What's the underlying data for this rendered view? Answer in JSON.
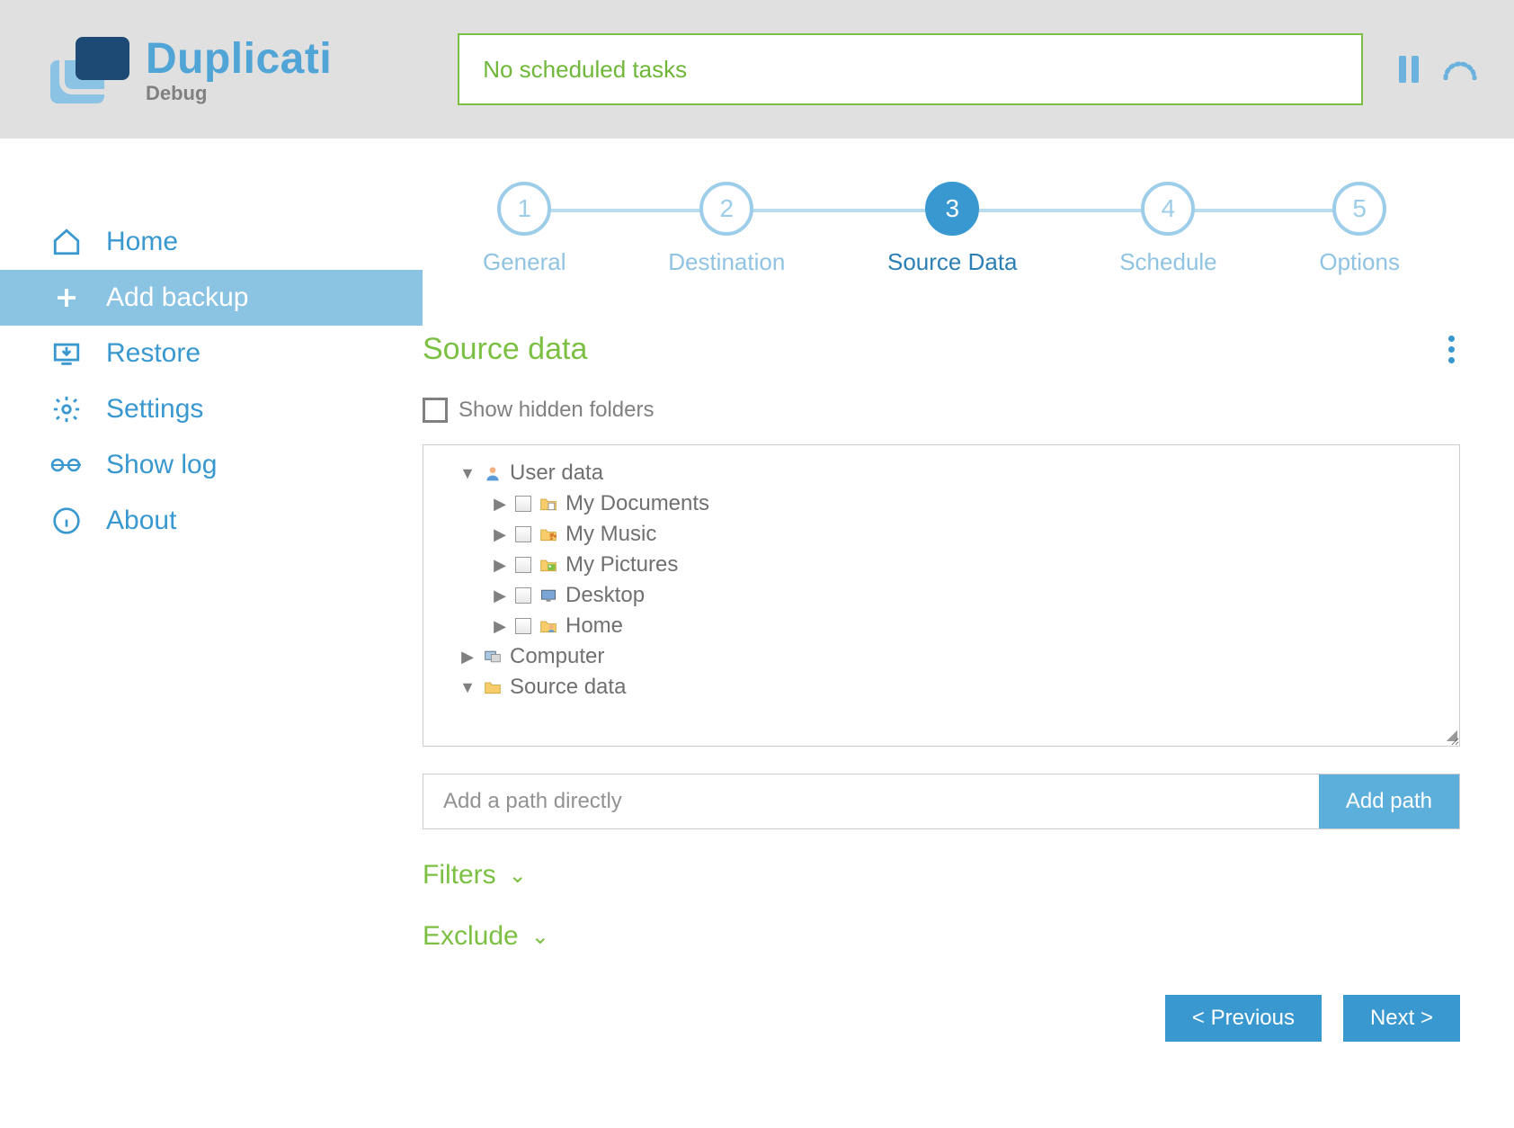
{
  "header": {
    "app_name": "Duplicati",
    "app_sub": "Debug",
    "status": "No scheduled tasks"
  },
  "sidebar": {
    "items": [
      {
        "label": "Home"
      },
      {
        "label": "Add backup"
      },
      {
        "label": "Restore"
      },
      {
        "label": "Settings"
      },
      {
        "label": "Show log"
      },
      {
        "label": "About"
      }
    ]
  },
  "stepper": {
    "steps": [
      {
        "num": "1",
        "label": "General"
      },
      {
        "num": "2",
        "label": "Destination"
      },
      {
        "num": "3",
        "label": "Source Data"
      },
      {
        "num": "4",
        "label": "Schedule"
      },
      {
        "num": "5",
        "label": "Options"
      }
    ],
    "active_index": 2
  },
  "section": {
    "title": "Source data",
    "show_hidden_label": "Show hidden folders"
  },
  "tree": {
    "rows": [
      {
        "indent": 0,
        "arrow": "down",
        "cb": false,
        "icon": "user",
        "label": "User data"
      },
      {
        "indent": 1,
        "arrow": "right",
        "cb": true,
        "icon": "folder-doc",
        "label": "My Documents"
      },
      {
        "indent": 1,
        "arrow": "right",
        "cb": true,
        "icon": "folder-music",
        "label": "My Music"
      },
      {
        "indent": 1,
        "arrow": "right",
        "cb": true,
        "icon": "folder-pic",
        "label": "My Pictures"
      },
      {
        "indent": 1,
        "arrow": "right",
        "cb": true,
        "icon": "desktop",
        "label": "Desktop"
      },
      {
        "indent": 1,
        "arrow": "right",
        "cb": true,
        "icon": "home",
        "label": "Home"
      },
      {
        "indent": 0,
        "arrow": "right",
        "cb": false,
        "icon": "computer",
        "label": "Computer"
      },
      {
        "indent": 0,
        "arrow": "down",
        "cb": false,
        "icon": "folder",
        "label": "Source data"
      }
    ]
  },
  "path": {
    "placeholder": "Add a path directly",
    "button": "Add path"
  },
  "collapsibles": {
    "filters": "Filters",
    "exclude": "Exclude"
  },
  "nav_buttons": {
    "prev": "< Previous",
    "next": "Next >"
  }
}
